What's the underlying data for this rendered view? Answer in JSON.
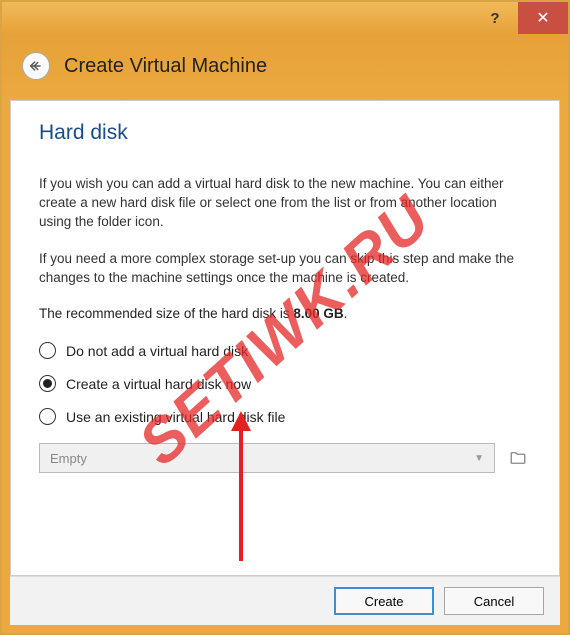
{
  "window": {
    "help_symbol": "?",
    "close_symbol": "✕"
  },
  "header": {
    "title": "Create Virtual Machine"
  },
  "section": {
    "title": "Hard disk"
  },
  "description": {
    "para1": "If you wish you can add a virtual hard disk to the new machine. You can either create a new hard disk file or select one from the list or from another location using the folder icon.",
    "para2": "If you need a more complex storage set-up you can skip this step and make the changes to the machine settings once the machine is created.",
    "recommend_prefix": "The recommended size of the hard disk is ",
    "recommend_size": "8.00 GB",
    "recommend_suffix": "."
  },
  "options": {
    "opt0": "Do not add a virtual hard disk",
    "opt1": "Create a virtual hard disk now",
    "opt2": "Use an existing virtual hard disk file",
    "selected_index": 1
  },
  "disk_select": {
    "value": "Empty"
  },
  "footer": {
    "create": "Create",
    "cancel": "Cancel"
  },
  "watermark": {
    "text": "SETIWK.RU"
  }
}
